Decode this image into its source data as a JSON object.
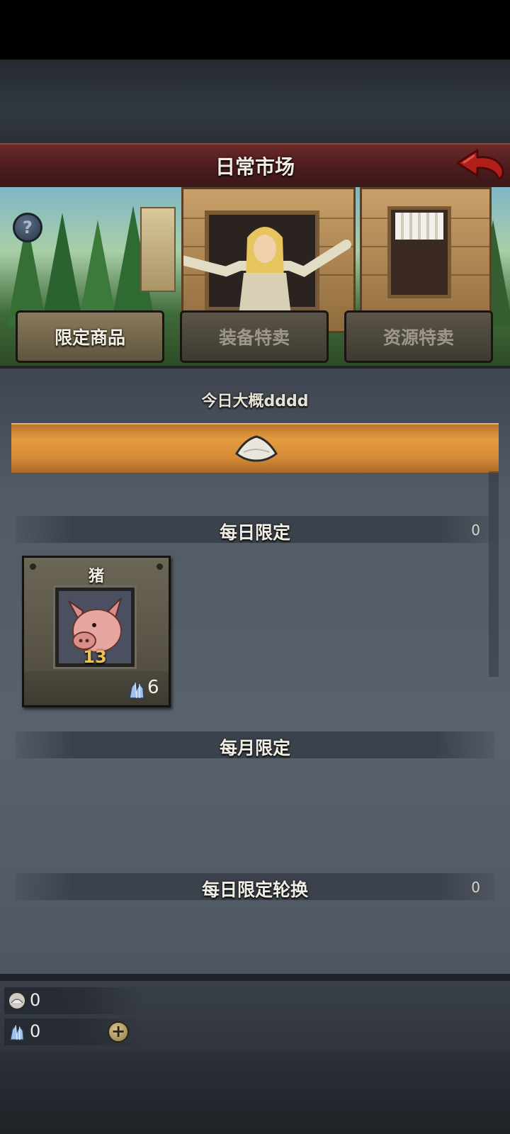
{
  "header": {
    "title": "日常市场"
  },
  "banner": {
    "tabs": [
      {
        "label": "限定商品",
        "active": true
      },
      {
        "label": "装备特卖",
        "active": false
      },
      {
        "label": "资源特卖",
        "active": false
      }
    ],
    "help_symbol": "?"
  },
  "notice": {
    "text": "今日大概dddd"
  },
  "sections": {
    "daily_limited": {
      "title": "每日限定",
      "count": "0"
    },
    "monthly_limited": {
      "title": "每月限定"
    },
    "daily_rotation": {
      "title": "每日限定轮换",
      "count": "0"
    }
  },
  "items": [
    {
      "name": "猪",
      "quantity": "13",
      "price": "6",
      "icon": "pig-head-icon",
      "price_icon": "crystal-icon"
    }
  ],
  "currency": {
    "salt": {
      "value": "0",
      "icon": "salt-coin-icon"
    },
    "crystal": {
      "value": "0",
      "icon": "crystal-icon",
      "add_symbol": "+"
    }
  },
  "colors": {
    "header_bg": "#5a2224",
    "accent_orange": "#e39a3f",
    "panel_bg": "#555d68",
    "qty_yellow": "#e8c25a"
  }
}
